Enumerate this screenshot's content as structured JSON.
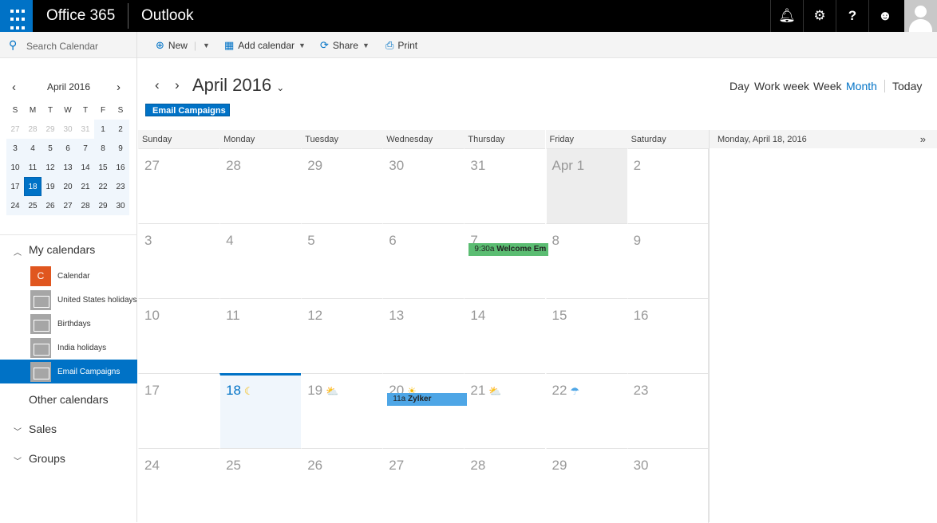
{
  "topbar": {
    "brand": "Office 365",
    "app": "Outlook"
  },
  "toolbar": {
    "search_placeholder": "Search Calendar",
    "new": "New",
    "add_calendar": "Add calendar",
    "share": "Share",
    "print": "Print"
  },
  "mini_calendar": {
    "title": "April 2016",
    "weekdays": [
      "S",
      "M",
      "T",
      "W",
      "T",
      "F",
      "S"
    ],
    "days": [
      [
        "27",
        "28",
        "29",
        "30",
        "31",
        "1",
        "2"
      ],
      [
        "3",
        "4",
        "5",
        "6",
        "7",
        "8",
        "9"
      ],
      [
        "10",
        "11",
        "12",
        "13",
        "14",
        "15",
        "16"
      ],
      [
        "17",
        "18",
        "19",
        "20",
        "21",
        "22",
        "23"
      ],
      [
        "24",
        "25",
        "26",
        "27",
        "28",
        "29",
        "30"
      ]
    ],
    "selected": "18"
  },
  "sidebar": {
    "my_calendars": "My calendars",
    "calendars": [
      {
        "label": "Calendar",
        "icon": "C"
      },
      {
        "label": "United States holidays"
      },
      {
        "label": "Birthdays"
      },
      {
        "label": "India holidays"
      },
      {
        "label": "Email Campaigns",
        "active": true
      }
    ],
    "other_calendars": "Other calendars",
    "sales": "Sales",
    "groups": "Groups"
  },
  "header": {
    "title": "April 2016",
    "views": [
      "Day",
      "Work week",
      "Week",
      "Month",
      "Today"
    ],
    "active_view": "Month",
    "tag": "Email Campaigns"
  },
  "month": {
    "weekdays": [
      "Sunday",
      "Monday",
      "Tuesday",
      "Wednesday",
      "Thursday",
      "Friday",
      "Saturday"
    ],
    "weeks": [
      [
        "27",
        "28",
        "29",
        "30",
        "31",
        "Apr 1",
        "2"
      ],
      [
        "3",
        "4",
        "5",
        "6",
        "7",
        "8",
        "9"
      ],
      [
        "10",
        "11",
        "12",
        "13",
        "14",
        "15",
        "16"
      ],
      [
        "17",
        "18",
        "19",
        "20",
        "21",
        "22",
        "23"
      ],
      [
        "24",
        "25",
        "26",
        "27",
        "28",
        "29",
        "30"
      ]
    ],
    "weather": {
      "3-1": "☾",
      "3-2": "⛅",
      "3-3": "☀",
      "3-4": "⛅",
      "3-5": "☂"
    },
    "events": [
      {
        "week": 1,
        "day": 4,
        "time": "9:30a",
        "title": "Welcome Em",
        "color": "#5bbd72"
      },
      {
        "week": 3,
        "day": 3,
        "time": "11a",
        "title": "Zylker",
        "color": "#4ea6e6"
      }
    ]
  },
  "right_pane": {
    "date": "Monday, April 18, 2016",
    "expand": "»"
  }
}
